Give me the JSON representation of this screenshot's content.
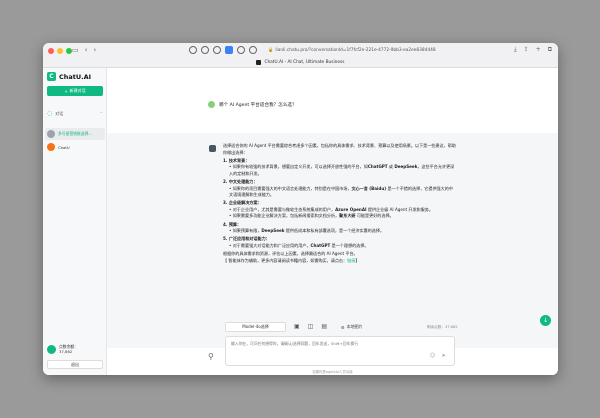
{
  "browser": {
    "url": "lianli.chatu.pro/?conversationId=1f7fcf2e-221e-4772-9bb3-ea2ee8384448",
    "tab_title": "ChatU.AI - AI Chat, Ultimate Business"
  },
  "sidebar": {
    "app_name": "ChatU.AI",
    "new_chat": "新建对话",
    "section_label": "对话",
    "conversations": [
      {
        "label": "多号星营销推选择..."
      },
      {
        "label": "ChatU"
      }
    ],
    "points_label": "点数余额：",
    "points_value": "37,862",
    "logout": "退出"
  },
  "chat": {
    "question": "哪个 AI Agent 平台适合我？怎么选？",
    "answer": {
      "intro": "选择适合你的 AI Agent 平台需要综合考虑多个因素，包括你的具体需求、技术背景、预算以及使用场景。以下是一些建议，帮助你做出选择：",
      "s1_title": "1. 技术背景：",
      "s1_b1_a": "如果你有较强的技术背景，想要自定义开发，可以选择开放性强的平台，如",
      "s1_b1_strong": "ChatGPT",
      "s1_b1_b": "或",
      "s1_b1_strong2": "DeepSeek",
      "s1_b1_c": "，这些平台允许更深入的定制和开发。",
      "s2_title": "2. 中文处理能力：",
      "s2_b1_a": "如果你的项目需要强大的中文语言处理能力，特别是在中国市场，",
      "s2_b1_strong": "文心一言 (Baidu)",
      "s2_b1_b": "是一个不错的选择，它提供强大的中文语境理解和生成能力。",
      "s3_title": "3. 企业级解决方案：",
      "s3_b1_a": "对于企业用户，尤其是需要与微软生态系统集成的用户，",
      "s3_b1_strong": "Azure OpenAI",
      "s3_b1_b": "提供企业级 AI Agent 开发和服务。",
      "s3_b2_a": "如果需要多功能企业解决方案，包括新闻搜索和文档分析，",
      "s3_b2_strong": "聚东大研",
      "s3_b2_b": "可能是更好的选择。",
      "s4_title": "4. 预算：",
      "s4_b1_a": "如果预算有限，",
      "s4_b1_strong": "DeepSeek",
      "s4_b1_b": "提供低成本和私有部署选项，是一个经济实惠的选择。",
      "s5_title": "5. 广泛应用和对话能力：",
      "s5_b1_a": "对于需要强大对话能力和广泛应用的用户，",
      "s5_b1_strong": "ChatGPT",
      "s5_b1_b": "是一个理想的选择。",
      "closing": "根据你的具体需求和资源，评估以上因素，选择最适合的 AI Agent 平台。",
      "note_a": "【 智能体作为辅助，更多内容请阅读书籍内容，如需购买，请点击：",
      "note_link": "链接",
      "note_b": "】"
    }
  },
  "composer": {
    "model_label": "Model-4o选择",
    "upload_label": "本地图片",
    "counter": "剩余点数：37,862",
    "placeholder": "输入你在，可问任何想得的，请确认/选择同题，回车发送，Shift+回车换行",
    "footer": "如果你是agentAI人员对接"
  }
}
